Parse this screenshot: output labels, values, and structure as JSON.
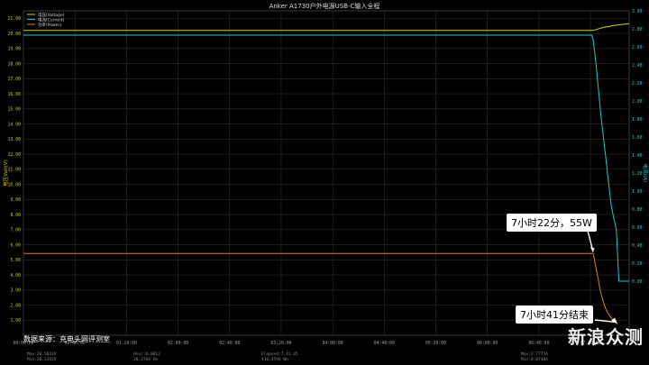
{
  "chart_data": {
    "type": "line",
    "title": "Anker A1730户外电源USB-C输入全程",
    "ylabel_left": "电压Volt(V)",
    "ylabel_right": "电流I(A)",
    "legend": [
      {
        "name": "电压(Voltage)",
        "color": "#d4d400"
      },
      {
        "name": "电流(Current)",
        "color": "#22c9c9"
      },
      {
        "name": "功率(Power)",
        "color": "#e0801e"
      }
    ],
    "legend_position": "top-left",
    "grid": true,
    "x_ticks": [
      "00:00:00",
      "00:40:00",
      "01:20:00",
      "02:00:00",
      "02:40:00",
      "03:20:00",
      "04:00:00",
      "04:40:00",
      "05:20:00",
      "06:00:00",
      "06:40:00",
      "07:20:00"
    ],
    "xlim": [
      0,
      470
    ],
    "y_left_ticks": [
      "1.00",
      "2.00",
      "3.00",
      "4.00",
      "5.00",
      "6.00",
      "7.00",
      "8.00",
      "9.00",
      "10.00",
      "11.00",
      "12.00",
      "13.00",
      "14.00",
      "15.00",
      "16.00",
      "17.00",
      "18.00",
      "19.00",
      "20.00",
      "21.00"
    ],
    "y_left_lim": [
      0,
      21.5
    ],
    "y_right_ticks": [
      "0.00",
      "0.20",
      "0.40",
      "0.60",
      "0.80",
      "1.00",
      "1.20",
      "1.40",
      "1.60",
      "1.80",
      "2.00",
      "2.20",
      "2.40",
      "2.60",
      "2.80",
      "3.00"
    ],
    "y_right_lim": [
      -0.6,
      3.0
    ],
    "series": [
      {
        "name": "电压(Voltage)",
        "axis": "left",
        "color": "#d4d400",
        "x": [
          0,
          60,
          120,
          180,
          240,
          300,
          360,
          420,
          442,
          450,
          460,
          470
        ],
        "y": [
          20.2,
          20.2,
          20.2,
          20.2,
          20.2,
          20.2,
          20.2,
          20.2,
          20.2,
          20.4,
          20.55,
          20.65
        ]
      },
      {
        "name": "电流(Current)",
        "axis": "right",
        "color": "#22c9c9",
        "x": [
          0,
          100,
          200,
          300,
          400,
          441,
          442,
          444,
          446,
          448,
          450,
          452,
          454,
          456,
          458,
          460,
          461,
          462,
          470
        ],
        "y": [
          2.73,
          2.73,
          2.73,
          2.73,
          2.73,
          2.73,
          2.68,
          2.45,
          2.15,
          1.85,
          1.6,
          1.35,
          1.1,
          0.85,
          0.7,
          0.58,
          0.3,
          0.0,
          0.0
        ]
      },
      {
        "name": "功率(Power)",
        "axis": "left",
        "color": "#e0801e",
        "x": [
          0,
          100,
          200,
          300,
          400,
          442,
          444,
          446,
          448,
          450,
          452,
          454,
          456,
          458,
          461
        ],
        "y": [
          5.42,
          5.42,
          5.42,
          5.42,
          5.42,
          5.42,
          4.6,
          3.7,
          2.8,
          2.2,
          1.7,
          1.4,
          1.15,
          0.95,
          0.75
        ]
      }
    ],
    "annotations": [
      {
        "text": "7小时22分，55W",
        "x": 442,
        "y": 5.42,
        "axis": "left"
      },
      {
        "text": "7小时41分结束",
        "x": 461,
        "y": 0.75,
        "axis": "left"
      }
    ],
    "source_note": "数据来源：充电头网评测室",
    "watermark": "新浪众测",
    "stats": {
      "voltage": [
        "Max:20.5641V",
        "Min:20.2342V"
      ],
      "elapsed_1": [
        "Hour:0.0012",
        "20.2784 Ah"
      ],
      "elapsed_2": [
        "Elapsed:7:41:45",
        "416.4594 Wh"
      ],
      "current": [
        "Max:2.7775A",
        "Min:0.0748A"
      ]
    }
  },
  "colors": {
    "background": "#000000",
    "grid": "#2c2c2c",
    "tick_text": "#9a9a9a",
    "left_axis": "#c8c800",
    "right_axis": "#22c9c9"
  }
}
